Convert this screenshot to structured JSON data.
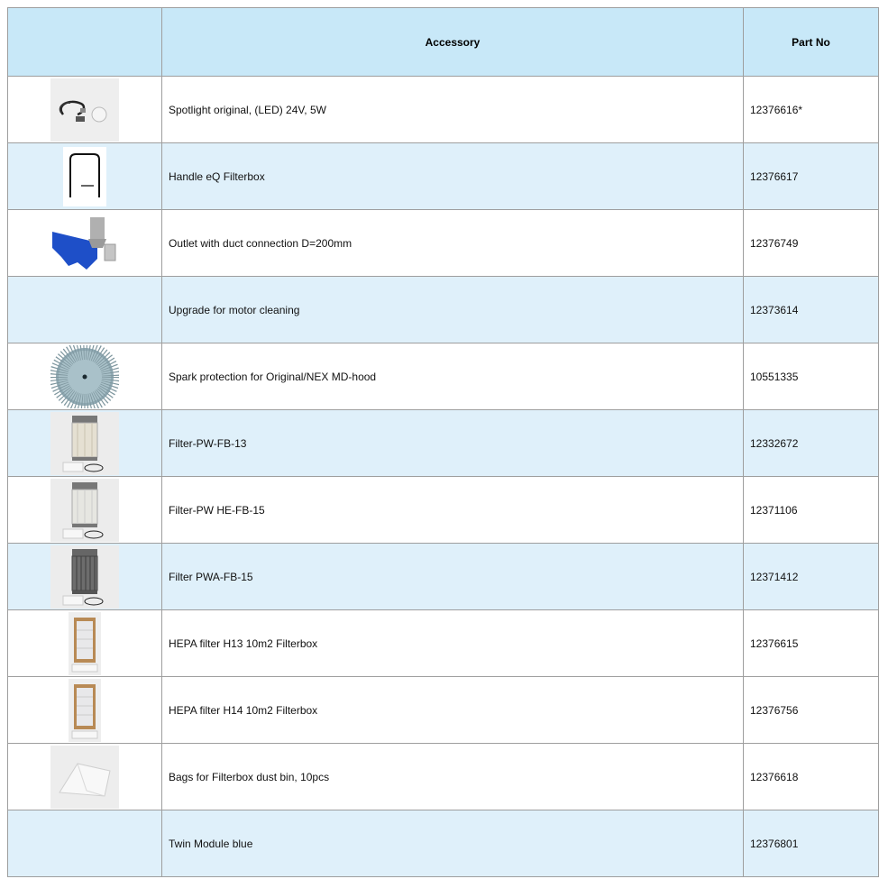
{
  "header": {
    "accessory": "Accessory",
    "part_no": "Part No"
  },
  "rows": [
    {
      "name": "Spotlight original, (LED) 24V, 5W",
      "part": "12376616*",
      "icon": "spotlight-lamp-icon"
    },
    {
      "name": "Handle eQ  Filterbox",
      "part": "12376617",
      "icon": "handle-icon"
    },
    {
      "name": "Outlet with duct connection D=200mm",
      "part": "12376749",
      "icon": "outlet-duct-icon"
    },
    {
      "name": "Upgrade for motor cleaning",
      "part": "12373614",
      "icon": ""
    },
    {
      "name": "Spark protection for Original/NEX MD-hood",
      "part": "10551335",
      "icon": "spark-protection-icon"
    },
    {
      "name": "Filter-PW-FB-13",
      "part": "12332672",
      "icon": "cartridge-filter-icon"
    },
    {
      "name": "Filter-PW HE-FB-15",
      "part": "12371106",
      "icon": "cartridge-filter-icon"
    },
    {
      "name": "Filter PWA-FB-15",
      "part": "12371412",
      "icon": "carbon-filter-icon"
    },
    {
      "name": "HEPA filter H13 10m2 Filterbox",
      "part": "12376615",
      "icon": "hepa-filter-icon"
    },
    {
      "name": "HEPA filter H14 10m2 Filterbox",
      "part": "12376756",
      "icon": "hepa-filter-icon"
    },
    {
      "name": "Bags for Filterbox dust bin, 10pcs",
      "part": "12376618",
      "icon": "dust-bag-icon"
    },
    {
      "name": "Twin Module blue",
      "part": "12376801",
      "icon": ""
    }
  ],
  "colors": {
    "header_bg": "#c8e8f8",
    "alt_row_bg": "#dff0fa",
    "border": "#9e9e9e"
  }
}
